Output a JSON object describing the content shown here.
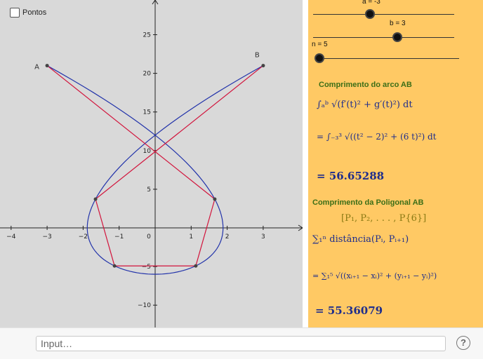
{
  "checkbox": {
    "label": "Pontos",
    "checked": false
  },
  "axes": {
    "x_ticks": [
      "−4",
      "−3",
      "−2",
      "−1",
      "0",
      "1",
      "2",
      "3"
    ],
    "y_ticks": [
      "25",
      "20",
      "15",
      "10",
      "5",
      "−5",
      "−10"
    ]
  },
  "points": {
    "A": "A",
    "B": "B"
  },
  "sliders": [
    {
      "label": "a = -3",
      "value": -3
    },
    {
      "label": "b = 3",
      "value": 3
    },
    {
      "label": "n = 5",
      "value": 5
    }
  ],
  "panel": {
    "arc_heading": "Comprimento do arco AB",
    "arc_integral_general": "∫ₐᵇ √(f′(t)² + g′(t)²) dt",
    "arc_integral_specific": "= ∫₋₃³ √((t² − 2)² + (6 t)²) dt",
    "arc_result": "= 56.65288",
    "poly_heading": "Comprimento da Poligonal AB",
    "poly_points": "[P₁, P₂, . . . , P{6}]",
    "poly_sum_general": "∑₁ⁿ distância(Pᵢ, Pᵢ₊₁)",
    "poly_sum_specific": "= ∑₁⁵ √((xᵢ₊₁ − xᵢ)² + (yᵢ₊₁ − yᵢ)²)",
    "poly_result": "= 55.36079"
  },
  "input_bar": {
    "placeholder": "Input…"
  },
  "help": {
    "symbol": "?"
  },
  "colors": {
    "curve": "#2233aa",
    "polygon": "#d2143c",
    "panel_bg": "#ffc964",
    "graphics_bg": "#d9d9d9"
  }
}
